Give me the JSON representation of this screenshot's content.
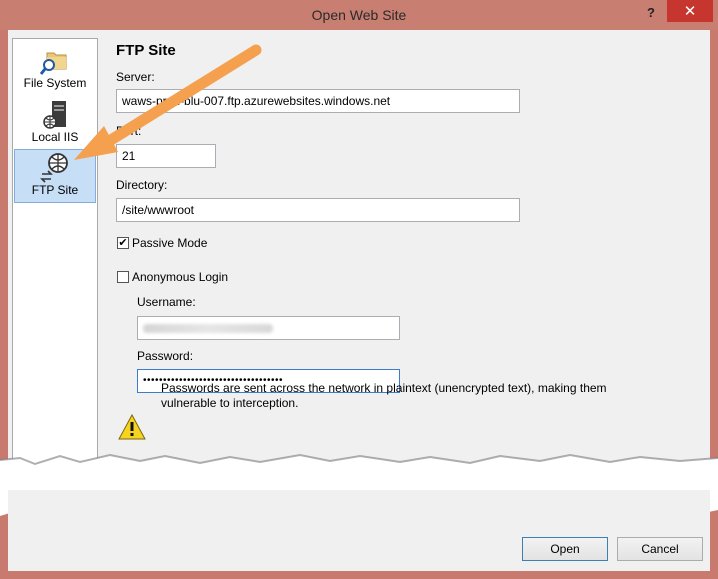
{
  "window": {
    "title": "Open Web Site",
    "help_glyph": "?",
    "close_glyph": "✕"
  },
  "sidebar": {
    "items": [
      {
        "label": "File System",
        "icon": "folder-search-icon"
      },
      {
        "label": "Local IIS",
        "icon": "server-icon"
      },
      {
        "label": "FTP Site",
        "icon": "globe-transfer-icon",
        "selected": true
      }
    ]
  },
  "form": {
    "heading": "FTP Site",
    "server_label": "Server:",
    "server_value": "waws-prod-blu-007.ftp.azurewebsites.windows.net",
    "port_label": "Port:",
    "port_value": "21",
    "directory_label": "Directory:",
    "directory_value": "/site/wwwroot",
    "passive_label": "Passive Mode",
    "passive_checked": true,
    "anonymous_label": "Anonymous Login",
    "anonymous_checked": false,
    "username_label": "Username:",
    "password_label": "Password:",
    "password_value": "•••••••••••••••••••••••••••••••••••"
  },
  "warning": {
    "icon": "warning-icon",
    "text": "Passwords are sent across the network in plaintext (unencrypted text), making them vulnerable to interception."
  },
  "buttons": {
    "open": "Open",
    "cancel": "Cancel"
  },
  "colors": {
    "accent_arrow": "#f4a04f",
    "selection": "#c7def7",
    "titlebar": "#c97e72",
    "close": "#c7362e"
  }
}
